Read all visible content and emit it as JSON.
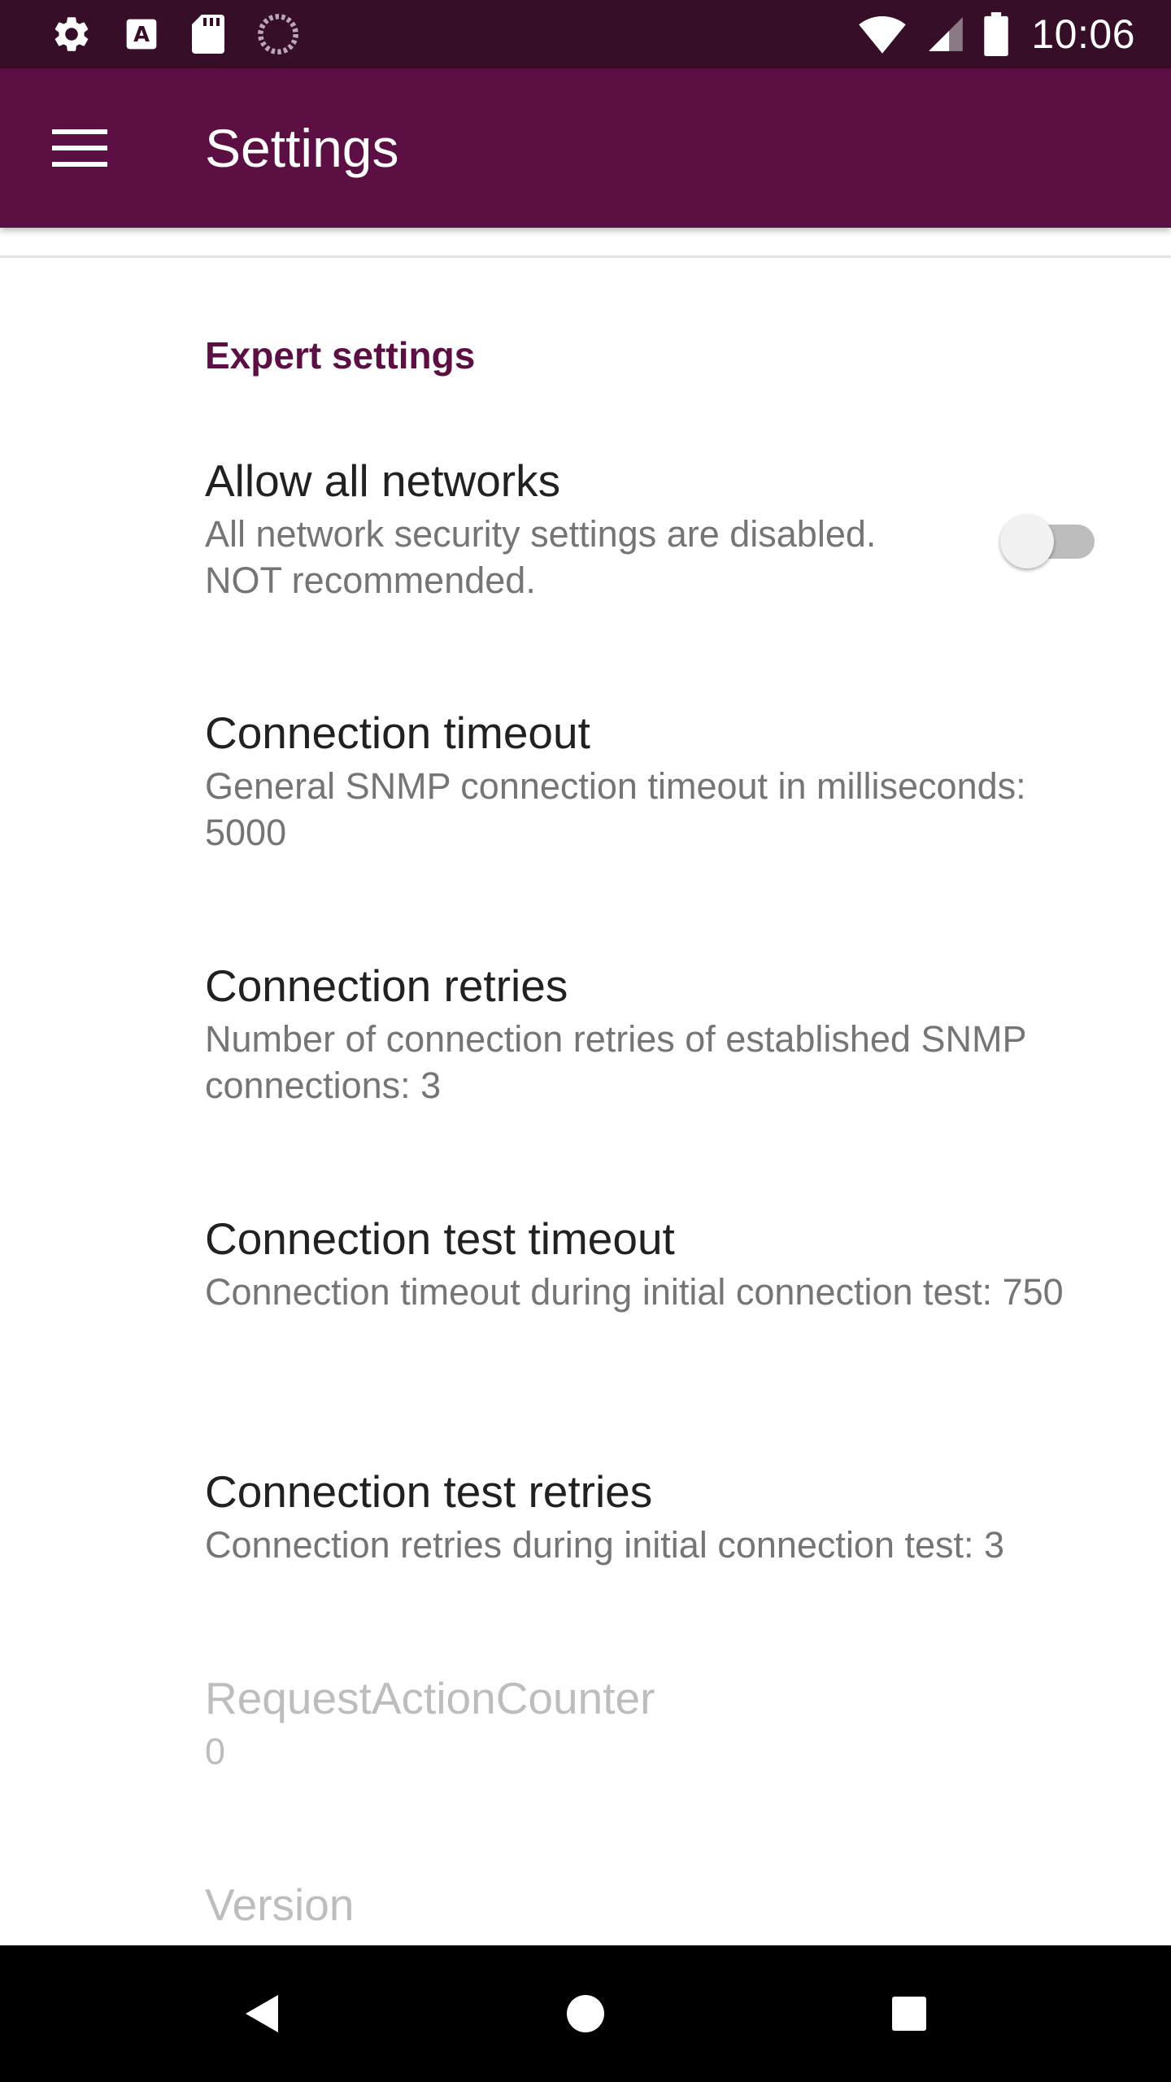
{
  "status_bar": {
    "time": "10:06",
    "left_icons": [
      "settings-icon",
      "text-a-icon",
      "sd-card-icon",
      "loading-icon"
    ],
    "right_icons": [
      "wifi-icon",
      "cell-signal-icon",
      "battery-icon"
    ]
  },
  "app_bar": {
    "title": "Settings",
    "menu_icon": "hamburger-menu-icon"
  },
  "section": {
    "header": "Expert settings"
  },
  "preferences": [
    {
      "title": "Allow all networks",
      "summary": "All network security settings are disabled. NOT recommended.",
      "switch_on": false
    },
    {
      "title": "Connection timeout",
      "summary": "General SNMP connection timeout in milliseconds: 5000"
    },
    {
      "title": "Connection retries",
      "summary": "Number of connection retries of established SNMP connections: 3"
    },
    {
      "title": "Connection test timeout",
      "summary": "Connection timeout during initial connection test: 750"
    },
    {
      "title": "Connection test retries",
      "summary": "Connection retries during initial connection test: 3"
    },
    {
      "title": "RequestActionCounter",
      "summary": "0",
      "disabled": true
    },
    {
      "title": "Version",
      "disabled": true
    }
  ],
  "nav_bar": {
    "buttons": [
      "back-icon",
      "home-icon",
      "recents-icon"
    ]
  },
  "colors": {
    "status_bar": "#370E27",
    "app_bar": "#5C0F43",
    "accent": "#5C0F43",
    "nav_bar": "#000000"
  }
}
